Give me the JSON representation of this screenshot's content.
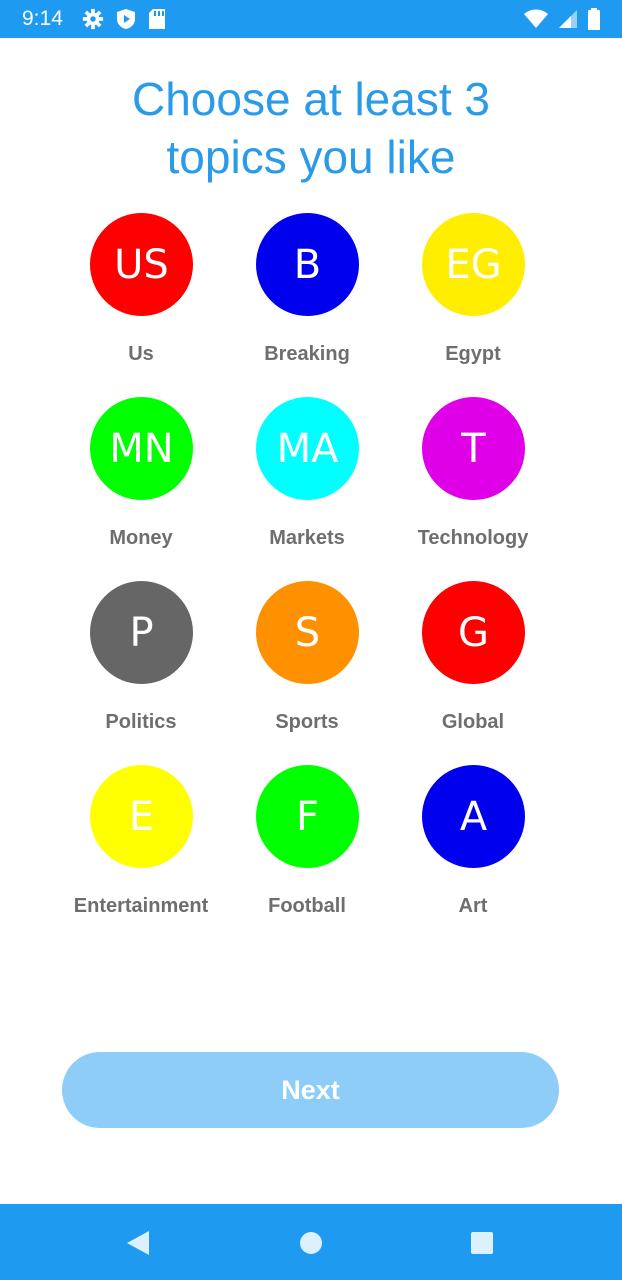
{
  "status_bar": {
    "time": "9:14",
    "color": "#1e9bf0",
    "left_icons": [
      "settings-gear-icon",
      "shield-play-icon",
      "sd-card-icon"
    ],
    "right_icons": [
      "wifi-icon",
      "cell-signal-icon",
      "battery-icon"
    ]
  },
  "title": {
    "line1": "Choose at least 3",
    "line2": "topics you like",
    "color": "#2a9be8"
  },
  "topics": [
    {
      "initials": "US",
      "label": "Us",
      "color": "#ff0000",
      "text_color": "#ffffff"
    },
    {
      "initials": "B",
      "label": "Breaking",
      "color": "#0000ee",
      "text_color": "#ffffff"
    },
    {
      "initials": "EG",
      "label": "Egypt",
      "color": "#ffee00",
      "text_color": "#ffffff"
    },
    {
      "initials": "MN",
      "label": "Money",
      "color": "#00ff00",
      "text_color": "#ffffff"
    },
    {
      "initials": "MA",
      "label": "Markets",
      "color": "#00ffff",
      "text_color": "#ffffff"
    },
    {
      "initials": "T",
      "label": "Technology",
      "color": "#e000e8",
      "text_color": "#ffffff"
    },
    {
      "initials": "P",
      "label": "Politics",
      "color": "#666666",
      "text_color": "#ffffff"
    },
    {
      "initials": "S",
      "label": "Sports",
      "color": "#ff9000",
      "text_color": "#ffffff"
    },
    {
      "initials": "G",
      "label": "Global",
      "color": "#ff0000",
      "text_color": "#ffffff"
    },
    {
      "initials": "E",
      "label": "Entertainment",
      "color": "#ffff00",
      "text_color": "#ffffff"
    },
    {
      "initials": "F",
      "label": "Football",
      "color": "#00ff00",
      "text_color": "#ffffff"
    },
    {
      "initials": "A",
      "label": "Art",
      "color": "#0000ee",
      "text_color": "#ffffff"
    }
  ],
  "next_button": {
    "label": "Next",
    "color": "#8dcdf8",
    "enabled": false
  },
  "nav_bar": {
    "color": "#1e9bf0",
    "buttons": [
      "back-triangle-icon",
      "home-circle-icon",
      "recents-square-icon"
    ]
  }
}
